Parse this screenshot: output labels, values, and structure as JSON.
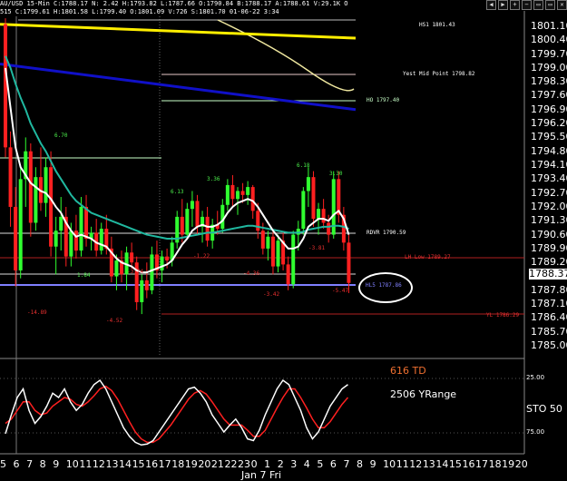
{
  "header": {
    "line1": "AU/USD 15-Min C:1788.17 N: 2.42 H:1793.82 L:1787.66 O:1790.84 B:1788.17 A:1788.61 V:29.1K O",
    "line2": "515 C:1799.61 H:1801.58 L:1799.40 O:1801.09 V:726 S:1801.70 01-06-22 3:34"
  },
  "toolbar": [
    "◀",
    "▶",
    "+",
    "−",
    "▭",
    "▭",
    "✕"
  ],
  "price_axis": {
    "labels": [
      "1801.10",
      "1800.40",
      "1799.70",
      "1799.00",
      "1798.30",
      "1797.60",
      "1796.90",
      "1796.20",
      "1795.50",
      "1794.80",
      "1794.10",
      "1793.40",
      "1792.70",
      "1792.00",
      "1791.30",
      "1790.60",
      "1789.90",
      "1789.20",
      "1787.80",
      "1787.10",
      "1786.40",
      "1785.70",
      "1785.00"
    ],
    "current_price": "1788.37"
  },
  "osc_axis": {
    "labels": [
      "25.00",
      "75.00"
    ],
    "sto_label": "STO  50"
  },
  "time_axis": {
    "labels": [
      "5",
      "6",
      "7",
      "8",
      "9",
      "10",
      "11",
      "12",
      "13",
      "14",
      "15",
      "16",
      "17",
      "18",
      "19",
      "20",
      "21",
      "22",
      "23",
      "0",
      "1",
      "2",
      "3",
      "4",
      "5",
      "6",
      "7",
      "8",
      "9",
      "10",
      "11",
      "12",
      "13",
      "14",
      "15",
      "16",
      "17",
      "18",
      "19",
      "20"
    ],
    "date": "Jan 7 Fri"
  },
  "levels": {
    "hs1": "HS1  1801.43",
    "yest_mid": "Yest Mid Point  1798.82",
    "ho": "HO  1797.40",
    "rdvr": "RDVR  1790.59",
    "lh_low": "LH Low  1789.27",
    "hl5": "HL5  1787.86",
    "yl": "YL  1786.29"
  },
  "annotations": {
    "a1": "6.70",
    "a2": "6.13",
    "a3": "3.36",
    "a4": "6.18",
    "a5": "3.30",
    "r1": "-14.89",
    "r2": "-4.52",
    "r3": "-1.22",
    "r4": "-4.36",
    "r5": "-3.42",
    "r6": "-5.47",
    "r7": "-3.81",
    "r8": "-3.74",
    "g1": "1.84"
  },
  "oscillator_text": {
    "td": "616 TD",
    "yrange": "2506 YRange"
  },
  "colors": {
    "yellow_line": "#ffee00",
    "blue_line": "#1010c8",
    "teal_ma": "#20b8a0",
    "white_ma": "#ffffff",
    "bull": "#30ff30",
    "bear": "#ff2020",
    "osc_red": "#ff2020"
  },
  "chart_data": {
    "type": "candlestick",
    "title": "",
    "ylim": [
      1784.5,
      1801.6
    ],
    "candles": [
      [
        1801.2,
        1801.5,
        1794.5,
        1795.0
      ],
      [
        1795.0,
        1795.8,
        1791.0,
        1792.0
      ],
      [
        1792.0,
        1793.0,
        1788.0,
        1788.8
      ],
      [
        1788.8,
        1794.0,
        1788.4,
        1793.4
      ],
      [
        1793.4,
        1795.5,
        1792.0,
        1794.8
      ],
      [
        1794.8,
        1795.2,
        1790.5,
        1791.2
      ],
      [
        1791.2,
        1794.0,
        1790.8,
        1793.5
      ],
      [
        1793.5,
        1795.0,
        1791.8,
        1792.2
      ],
      [
        1792.2,
        1794.5,
        1791.5,
        1794.0
      ],
      [
        1794.0,
        1794.8,
        1789.5,
        1790.0
      ],
      [
        1790.0,
        1791.5,
        1788.6,
        1790.8
      ],
      [
        1790.8,
        1792.5,
        1789.8,
        1791.5
      ],
      [
        1791.5,
        1792.0,
        1789.0,
        1789.5
      ],
      [
        1789.5,
        1791.2,
        1789.0,
        1790.8
      ],
      [
        1790.8,
        1791.6,
        1789.4,
        1789.8
      ],
      [
        1789.8,
        1792.5,
        1789.5,
        1792.0
      ],
      [
        1792.0,
        1792.6,
        1790.0,
        1790.4
      ],
      [
        1790.4,
        1791.0,
        1789.8,
        1790.7
      ],
      [
        1790.7,
        1791.4,
        1789.5,
        1789.8
      ],
      [
        1789.8,
        1791.2,
        1789.6,
        1790.9
      ],
      [
        1790.9,
        1791.6,
        1789.6,
        1789.9
      ],
      [
        1789.9,
        1790.5,
        1788.2,
        1788.5
      ],
      [
        1788.5,
        1789.6,
        1787.8,
        1789.3
      ],
      [
        1789.3,
        1789.8,
        1788.2,
        1788.6
      ],
      [
        1788.6,
        1790.0,
        1787.8,
        1789.7
      ],
      [
        1789.7,
        1790.2,
        1788.9,
        1789.2
      ],
      [
        1789.2,
        1789.5,
        1786.8,
        1787.2
      ],
      [
        1787.2,
        1788.6,
        1786.6,
        1788.3
      ],
      [
        1788.3,
        1789.2,
        1787.4,
        1787.8
      ],
      [
        1787.8,
        1790.0,
        1787.6,
        1789.6
      ],
      [
        1789.6,
        1790.3,
        1788.4,
        1788.8
      ],
      [
        1788.8,
        1789.8,
        1788.2,
        1789.5
      ],
      [
        1789.5,
        1789.9,
        1788.9,
        1789.3
      ],
      [
        1789.3,
        1790.5,
        1789.0,
        1790.2
      ],
      [
        1790.2,
        1791.8,
        1789.9,
        1791.5
      ],
      [
        1791.5,
        1792.4,
        1790.2,
        1790.6
      ],
      [
        1790.6,
        1792.2,
        1790.4,
        1791.9
      ],
      [
        1791.9,
        1792.8,
        1791.0,
        1792.3
      ],
      [
        1792.3,
        1792.6,
        1790.6,
        1791.0
      ],
      [
        1791.0,
        1791.8,
        1790.2,
        1791.5
      ],
      [
        1791.5,
        1792.0,
        1790.0,
        1790.3
      ],
      [
        1790.3,
        1791.4,
        1789.9,
        1791.1
      ],
      [
        1791.1,
        1791.8,
        1790.6,
        1790.9
      ],
      [
        1790.9,
        1792.4,
        1790.7,
        1792.1
      ],
      [
        1792.1,
        1793.4,
        1791.8,
        1793.1
      ],
      [
        1793.1,
        1793.6,
        1792.0,
        1792.4
      ],
      [
        1792.4,
        1793.0,
        1791.6,
        1792.8
      ],
      [
        1792.8,
        1793.2,
        1792.2,
        1792.6
      ],
      [
        1792.6,
        1793.3,
        1792.1,
        1793.0
      ],
      [
        1793.0,
        1793.1,
        1791.4,
        1791.8
      ],
      [
        1791.8,
        1792.2,
        1790.4,
        1790.8
      ],
      [
        1790.8,
        1791.2,
        1789.6,
        1789.9
      ],
      [
        1789.9,
        1790.8,
        1789.3,
        1790.5
      ],
      [
        1790.5,
        1790.9,
        1788.6,
        1789.0
      ],
      [
        1789.0,
        1790.6,
        1788.7,
        1790.3
      ],
      [
        1790.3,
        1790.7,
        1788.8,
        1789.1
      ],
      [
        1789.1,
        1789.5,
        1787.8,
        1788.1
      ],
      [
        1788.1,
        1790.8,
        1787.9,
        1790.6
      ],
      [
        1790.6,
        1791.3,
        1789.8,
        1790.9
      ],
      [
        1790.9,
        1793.0,
        1790.6,
        1792.8
      ],
      [
        1792.8,
        1794.0,
        1792.0,
        1793.5
      ],
      [
        1793.5,
        1793.8,
        1791.0,
        1791.4
      ],
      [
        1791.4,
        1792.2,
        1790.6,
        1791.9
      ],
      [
        1791.9,
        1792.4,
        1790.9,
        1791.2
      ],
      [
        1791.2,
        1791.6,
        1790.2,
        1790.6
      ],
      [
        1790.6,
        1793.8,
        1790.4,
        1793.4
      ],
      [
        1793.4,
        1793.8,
        1791.2,
        1791.6
      ],
      [
        1791.6,
        1792.0,
        1789.8,
        1790.2
      ],
      [
        1790.2,
        1790.6,
        1787.66,
        1788.17
      ]
    ],
    "moving_averages": [
      {
        "name": "",
        "color": "#20b8a0",
        "values": [
          1799.6,
          1799.0,
          1798.2,
          1797.5,
          1796.9,
          1796.2,
          1795.7,
          1795.2,
          1794.8,
          1794.3,
          1793.8,
          1793.4,
          1793.0,
          1792.6,
          1792.3,
          1792.1,
          1791.9,
          1791.7,
          1791.6,
          1791.5,
          1791.4,
          1791.3,
          1791.2,
          1791.1,
          1791.0,
          1790.9,
          1790.8,
          1790.7,
          1790.6,
          1790.55,
          1790.5,
          1790.45,
          1790.4,
          1790.4,
          1790.4,
          1790.45,
          1790.5,
          1790.55,
          1790.6,
          1790.65,
          1790.7,
          1790.7,
          1790.75,
          1790.8,
          1790.85,
          1790.9,
          1790.95,
          1791.0,
          1791.05,
          1791.05,
          1791.0,
          1790.95,
          1790.9,
          1790.85,
          1790.8,
          1790.75,
          1790.7,
          1790.7,
          1790.7,
          1790.75,
          1790.85,
          1790.9,
          1790.95,
          1791.0,
          1791.0,
          1791.05,
          1791.05,
          1791.0,
          1790.9
        ]
      },
      {
        "name": "",
        "color": "#ffffff",
        "values": [
          1799.0,
          1797.0,
          1795.0,
          1794.0,
          1793.6,
          1793.2,
          1793.0,
          1792.8,
          1792.7,
          1792.4,
          1792.0,
          1791.7,
          1791.2,
          1790.8,
          1790.5,
          1790.6,
          1790.5,
          1790.4,
          1790.2,
          1790.1,
          1790.0,
          1789.7,
          1789.4,
          1789.2,
          1789.1,
          1789.0,
          1788.8,
          1788.7,
          1788.7,
          1788.8,
          1788.9,
          1789.0,
          1789.1,
          1789.3,
          1789.7,
          1790.1,
          1790.4,
          1790.8,
          1791.0,
          1791.1,
          1791.0,
          1791.0,
          1791.1,
          1791.3,
          1791.7,
          1792.0,
          1792.2,
          1792.3,
          1792.4,
          1792.3,
          1792.0,
          1791.6,
          1791.2,
          1790.8,
          1790.5,
          1790.2,
          1789.9,
          1789.9,
          1790.0,
          1790.4,
          1791.0,
          1791.2,
          1791.4,
          1791.4,
          1791.3,
          1791.6,
          1791.8,
          1791.4,
          1790.6
        ]
      }
    ],
    "trend_lines": [
      {
        "name": "",
        "color": "#ffee00",
        "from": [
          0,
          1801.2
        ],
        "to": [
          1,
          1800.5
        ]
      },
      {
        "name": "",
        "color": "#1010c8",
        "from": [
          0,
          1799.2
        ],
        "to": [
          1,
          1796.9
        ]
      }
    ],
    "oscillator": {
      "ylim": [
        0,
        100
      ],
      "fast": [
        82,
        60,
        40,
        30,
        55,
        70,
        62,
        50,
        35,
        40,
        30,
        45,
        55,
        48,
        35,
        25,
        20,
        30,
        45,
        60,
        75,
        85,
        92,
        95,
        94,
        90,
        80,
        70,
        60,
        50,
        40,
        30,
        28,
        35,
        45,
        60,
        70,
        80,
        72,
        65,
        75,
        88,
        90,
        78,
        60,
        45,
        30,
        20,
        25,
        40,
        55,
        75,
        88,
        80,
        65,
        50,
        40,
        30,
        25
      ],
      "slow": [
        70,
        65,
        55,
        45,
        45,
        55,
        60,
        58,
        50,
        45,
        40,
        42,
        48,
        50,
        45,
        38,
        30,
        27,
        32,
        42,
        55,
        68,
        80,
        88,
        92,
        92,
        88,
        80,
        72,
        62,
        52,
        42,
        35,
        32,
        36,
        45,
        55,
        65,
        72,
        72,
        72,
        78,
        85,
        85,
        78,
        65,
        52,
        40,
        30,
        30,
        40,
        52,
        65,
        75,
        75,
        68,
        58,
        48,
        40
      ]
    }
  }
}
